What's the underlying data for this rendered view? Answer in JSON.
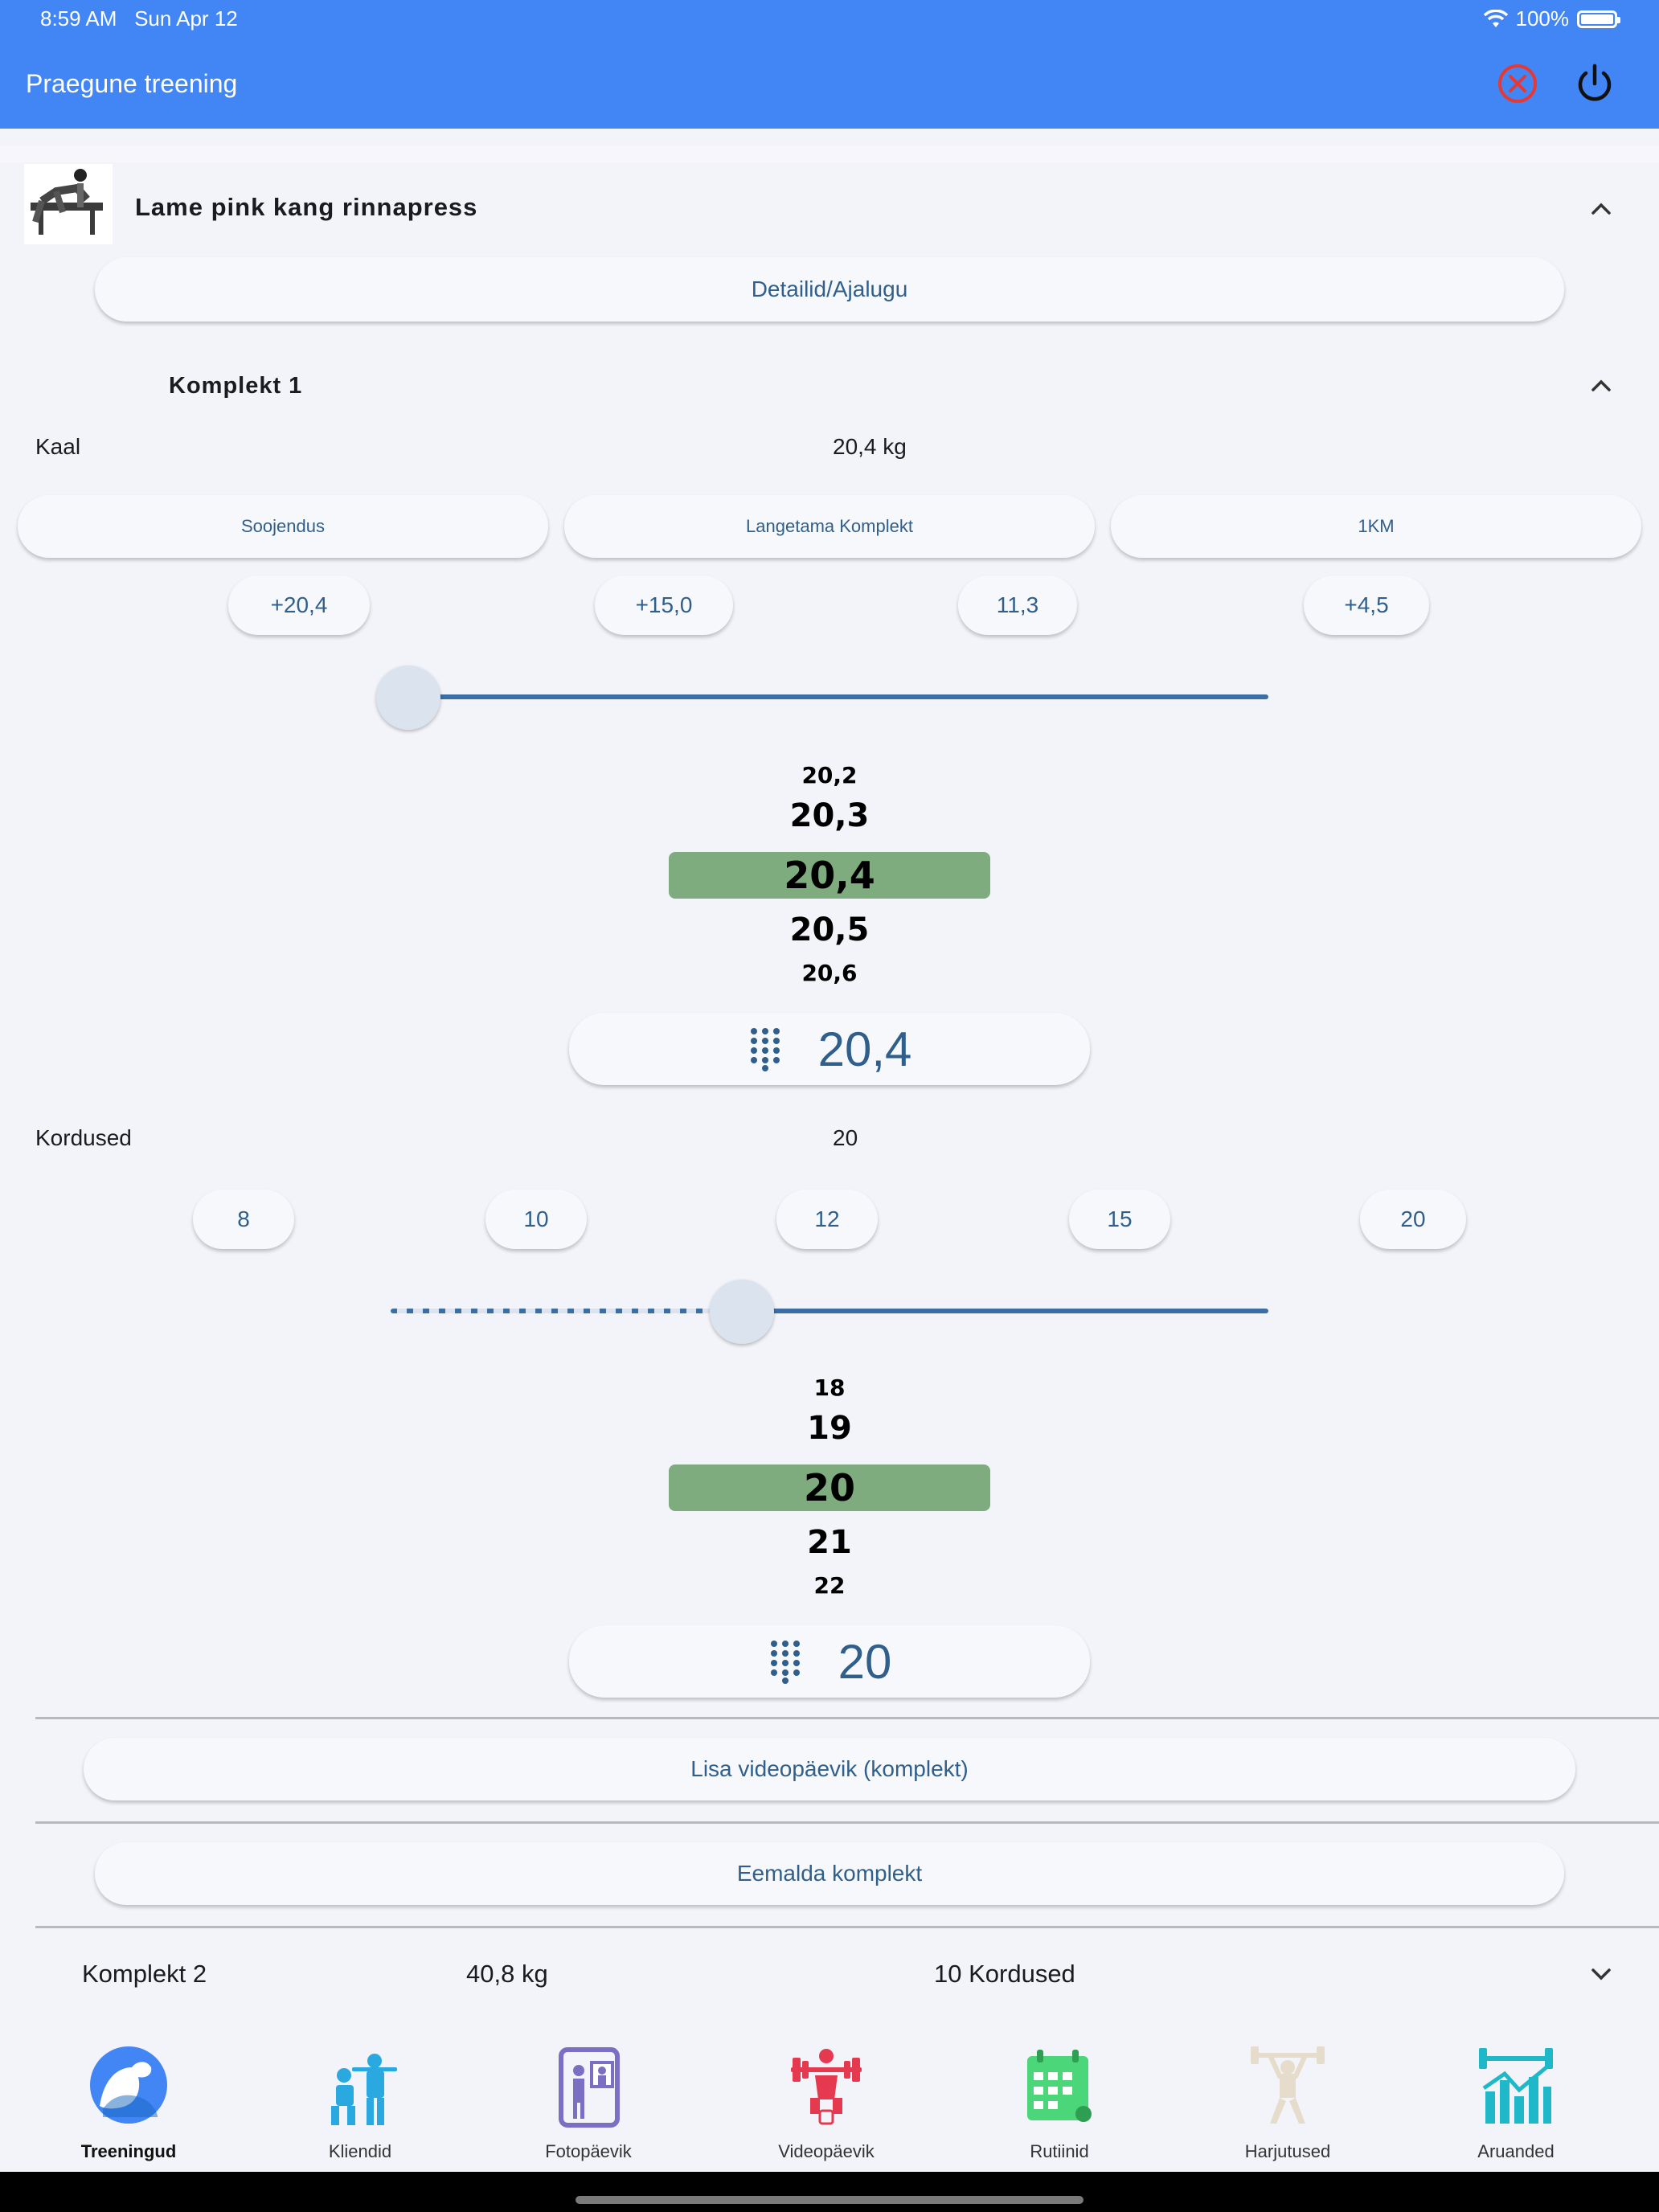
{
  "status_bar": {
    "time": "8:59 AM",
    "date": "Sun Apr 12",
    "battery": "100%"
  },
  "appbar": {
    "title": "Praegune treening"
  },
  "exercise": {
    "title": "Lame pink kang rinnapress",
    "details_button": "Detailid/Ajalugu"
  },
  "set1": {
    "title": "Komplekt 1",
    "weight_label": "Kaal",
    "weight_value": "20,4 kg",
    "mode_buttons": [
      "Soojendus",
      "Langetama Komplekt",
      "1KM"
    ],
    "weight_chips": [
      "+20,4",
      "+15,0",
      "11,3",
      "+4,5"
    ],
    "weight_slider_fraction": 0.0,
    "weight_wheel": [
      "20,2",
      "20,3",
      "20,4",
      "20,5",
      "20,6"
    ],
    "weight_input": "20,4",
    "reps_label": "Kordused",
    "reps_value": "20",
    "reps_chips": [
      "8",
      "10",
      "12",
      "15",
      "20"
    ],
    "reps_slider_fraction": 0.4,
    "reps_wheel": [
      "18",
      "19",
      "20",
      "21",
      "22"
    ],
    "reps_input": "20",
    "video_button": "Lisa videopäevik (komplekt)",
    "remove_button": "Eemalda komplekt"
  },
  "set2": {
    "title": "Komplekt 2",
    "weight": "40,8 kg",
    "reps": "10 Kordused"
  },
  "bottom_nav": [
    {
      "label": "Treeningud",
      "icon": "flexed-arm-icon",
      "active": true
    },
    {
      "label": "Kliendid",
      "icon": "trainer-client-icon",
      "active": false
    },
    {
      "label": "Fotopäevik",
      "icon": "photo-diary-icon",
      "active": false
    },
    {
      "label": "Videopäevik",
      "icon": "video-diary-icon",
      "active": false
    },
    {
      "label": "Rutiinid",
      "icon": "calendar-routine-icon",
      "active": false
    },
    {
      "label": "Harjutused",
      "icon": "weightlifter-icon",
      "active": false
    },
    {
      "label": "Aruanded",
      "icon": "reports-chart-icon",
      "active": false
    }
  ],
  "colors": {
    "appbar": "#4285f4",
    "accent": "#3a6ea5",
    "wheel_highlight": "#7fac7f"
  }
}
